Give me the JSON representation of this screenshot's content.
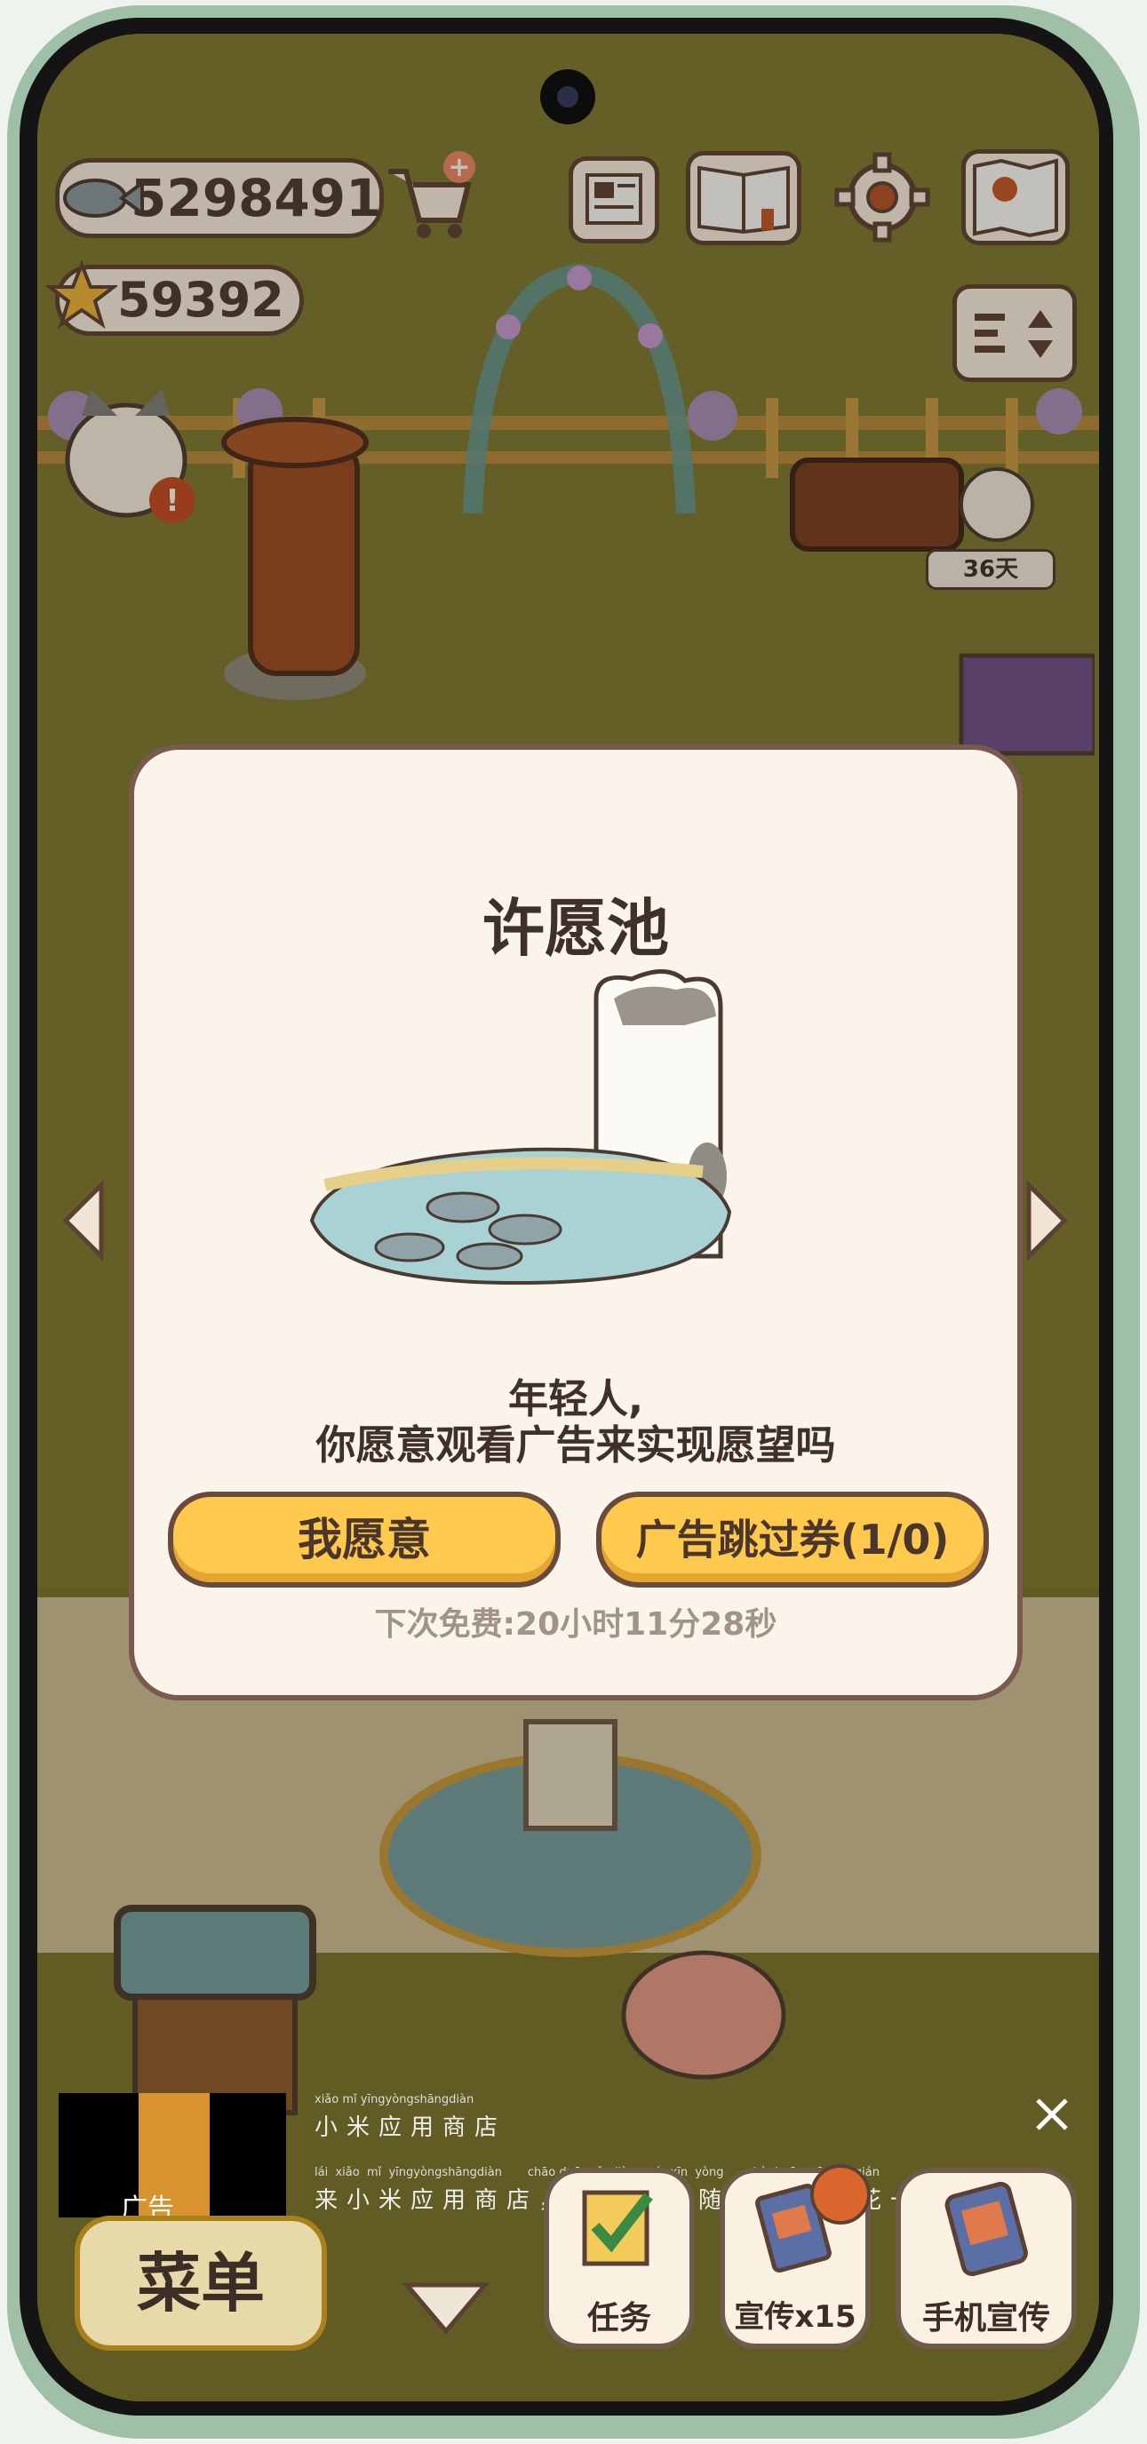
{
  "hud": {
    "fish_count": "5298491",
    "star_count": "59392"
  },
  "scene": {
    "days_badge": "36天"
  },
  "wishing_pool_dialog": {
    "title": "许愿池",
    "message_line1": "年轻人,",
    "message_line2": "你愿意观看广告来实现愿望吗",
    "confirm_label": "我愿意",
    "skip_ticket_label": "广告跳过券(1/0)",
    "next_free_text": "下次免费:20小时11分28秒"
  },
  "ad_banner": {
    "ad_tag": "广告",
    "pinyin_line1": "xiǎo  mǐ  yīngyòngshāngdiàn",
    "title": "小米应用商店",
    "pinyin_line2": "lái  xiǎo  mǐ  yīngyòngshāngdiàn       chāo duō ruǎn jiàn  suí   xīn  yòng        bù  huā    yī  fēn  qián",
    "subtitle": "来小米应用商店，超多软件随心用，不花一分钱！"
  },
  "bottom_bar": {
    "menu_label": "菜单",
    "tasks_label": "任务",
    "promo_label": "宣传x15",
    "phone_promo_label": "手机宣传"
  },
  "colors": {
    "grass": "#79752e",
    "dialog_bg": "#fbf4ea",
    "button_yellow": "#ffc94d",
    "border_brown": "#6a4a3d"
  }
}
